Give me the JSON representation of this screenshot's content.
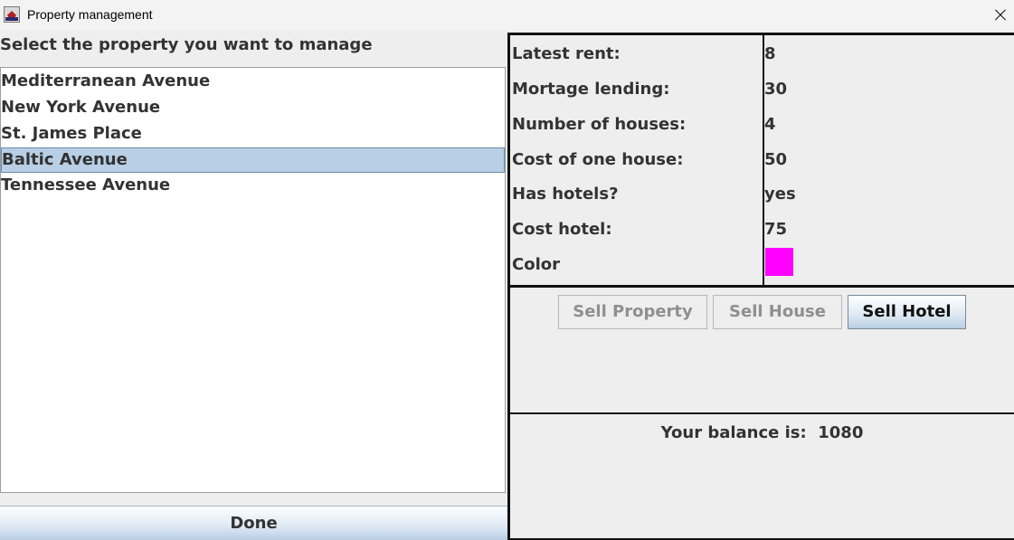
{
  "window": {
    "title": "Property management"
  },
  "left": {
    "heading": "Select the property you want to manage",
    "properties": [
      "Mediterranean Avenue",
      "New York Avenue",
      "St. James Place",
      "Baltic Avenue",
      "Tennessee Avenue"
    ],
    "selected": "Baltic Avenue",
    "done_label": "Done"
  },
  "details": {
    "rows": [
      {
        "label": "Latest rent:",
        "value": "8"
      },
      {
        "label": "Mortage lending:",
        "value": "30"
      },
      {
        "label": "Number of houses:",
        "value": "4"
      },
      {
        "label": "Cost of one house:",
        "value": "50"
      },
      {
        "label": "Has hotels?",
        "value": "yes"
      },
      {
        "label": "Cost hotel:",
        "value": "75"
      },
      {
        "label": "Color",
        "value": ""
      }
    ],
    "color_swatch": "#ff00ff"
  },
  "actions": {
    "sell_property": "Sell Property",
    "sell_house": "Sell House",
    "sell_hotel": "Sell Hotel"
  },
  "balance": {
    "text": "Your balance is:  1080"
  },
  "colors": {
    "selection_bg": "#b8cfe5",
    "window_bg": "#eeeeee",
    "text": "#333333",
    "disabled_text": "#8f8f8f"
  }
}
